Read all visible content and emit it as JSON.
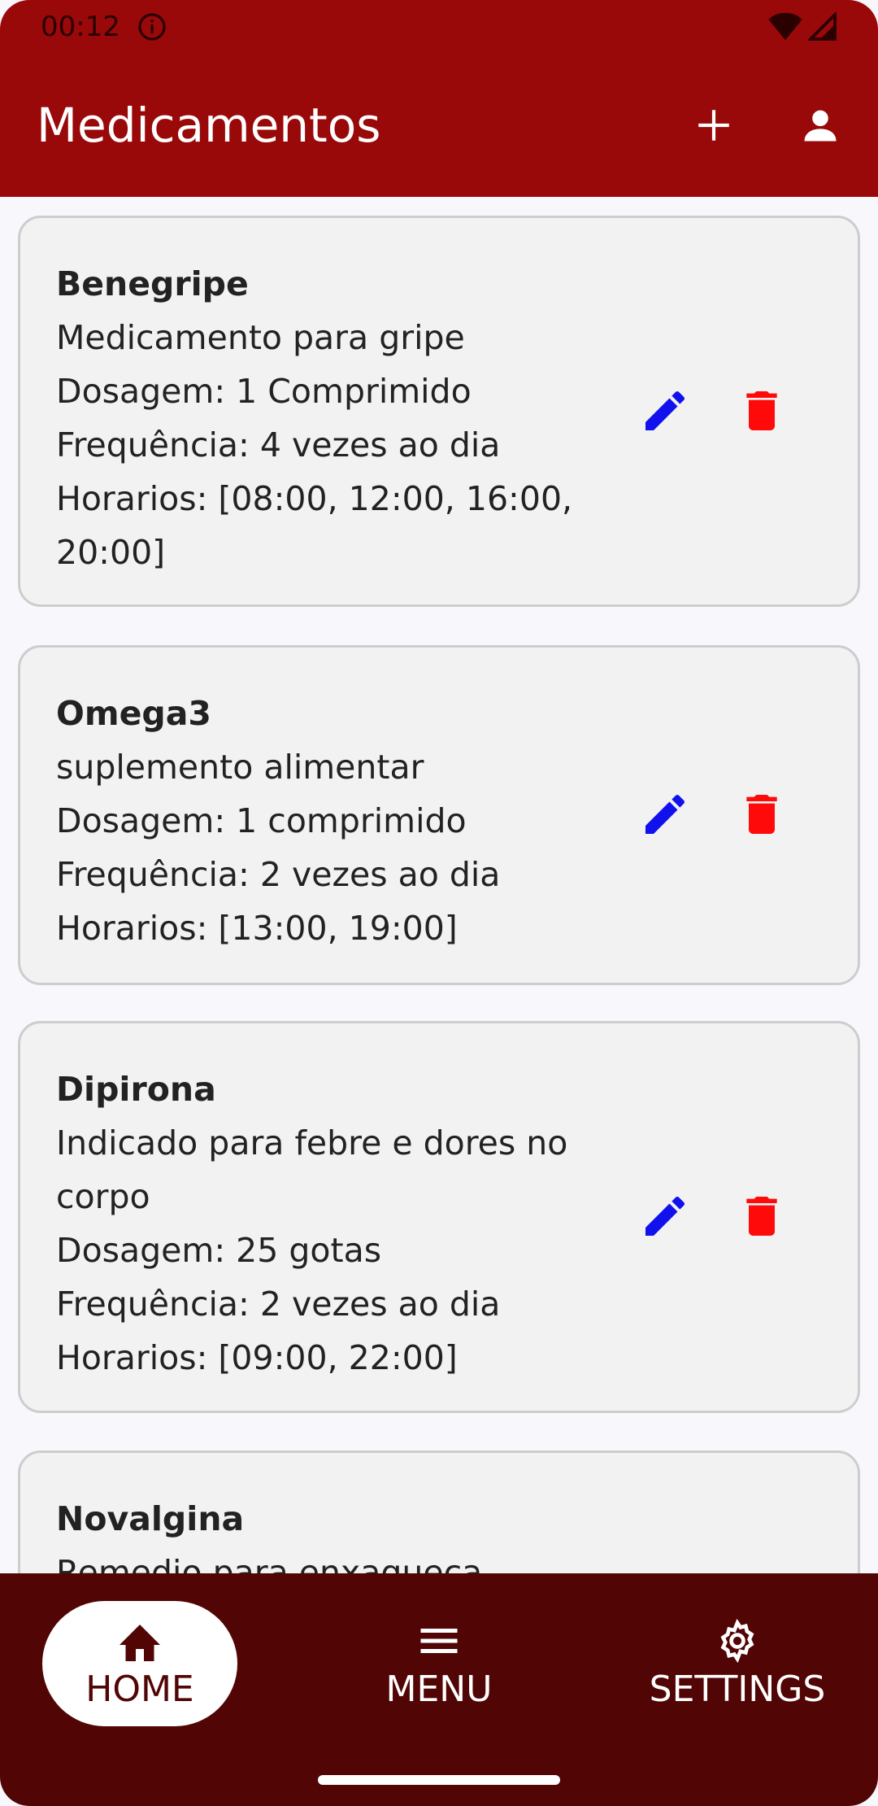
{
  "status_bar": {
    "time": "00:12",
    "icons": [
      "info-icon",
      "wifi-icon",
      "signal-icon"
    ]
  },
  "app_bar": {
    "title": "Medicamentos",
    "actions": [
      "add-icon",
      "person-icon"
    ]
  },
  "colors": {
    "primary": "#990909",
    "nav_background": "#520505",
    "edit": "#1111ee",
    "delete": "#ff0a0a",
    "card": "#f2f2f2"
  },
  "medications": [
    {
      "name": "Benegripe",
      "description": "Medicamento para gripe",
      "dosage": "Dosagem: 1 Comprimido",
      "frequency": "Frequência: 4 vezes ao dia",
      "schedule": "Horarios: [08:00, 12:00, 16:00, 20:00]"
    },
    {
      "name": "Omega3",
      "description": "suplemento alimentar",
      "dosage": "Dosagem: 1 comprimido",
      "frequency": "Frequência: 2 vezes ao dia",
      "schedule": "Horarios: [13:00, 19:00]"
    },
    {
      "name": "Dipirona",
      "description": "Indicado para febre e dores no corpo",
      "dosage": "Dosagem: 25 gotas",
      "frequency": "Frequência: 2 vezes ao dia",
      "schedule": "Horarios: [09:00, 22:00]"
    },
    {
      "name": "Novalgina",
      "description": "Remedio para enxaqueca"
    }
  ],
  "bottom_nav": [
    {
      "label": "HOME",
      "icon": "home-icon",
      "active": true
    },
    {
      "label": "MENU",
      "icon": "menu-icon",
      "active": false
    },
    {
      "label": "SETTINGS",
      "icon": "settings-icon",
      "active": false
    }
  ]
}
